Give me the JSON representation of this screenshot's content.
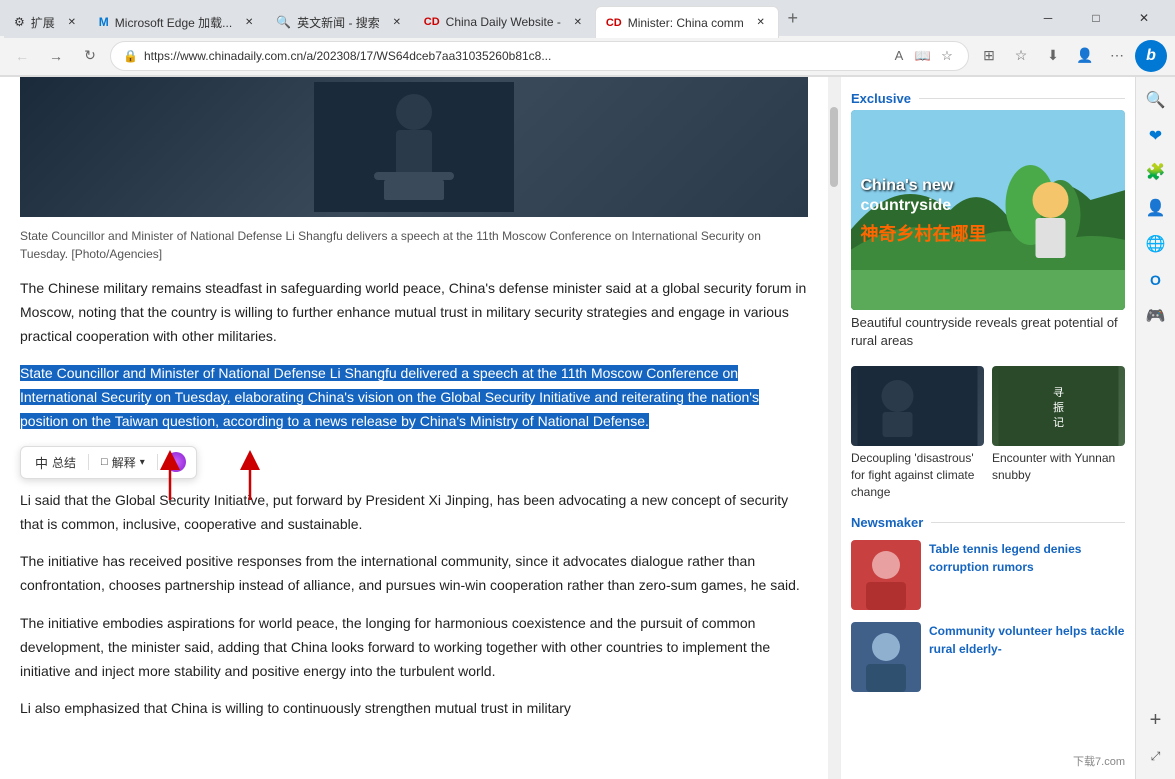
{
  "browser": {
    "tabs": [
      {
        "id": "tab1",
        "label": "扩展",
        "icon": "⚙",
        "active": false
      },
      {
        "id": "tab2",
        "label": "Microsoft Edge 加载...",
        "icon": "M",
        "active": false
      },
      {
        "id": "tab3",
        "label": "英文新闻 - 搜索",
        "icon": "🔍",
        "active": false
      },
      {
        "id": "tab4",
        "label": "China Daily Website -",
        "icon": "CD",
        "active": false
      },
      {
        "id": "tab5",
        "label": "Minister: China comm",
        "icon": "CD",
        "active": true
      }
    ],
    "url": "https://www.chinadaily.com.cn/a/202308/17/WS64dceb7aa31035260b81c8...",
    "window_controls": {
      "minimize": "─",
      "maximize": "□",
      "close": "✕"
    }
  },
  "article": {
    "caption": "State Councillor and Minister of National Defense Li Shangfu delivers a speech at the 11th Moscow Conference on International Security on Tuesday. [Photo/Agencies]",
    "para1": "The Chinese military remains steadfast in safeguarding world peace, China's defense minister said at a global security forum in Moscow, noting that the country is willing to further enhance mutual trust in military security strategies and engage in various practical cooperation with other militaries.",
    "highlighted": "State Councillor and Minister of National Defense Li Shangfu delivered a speech at the 11th Moscow Conference on International Security on Tuesday, elaborating China's vision on the Global Security Initiative and reiterating the nation's position on the Taiwan question, according to a news release by China's Ministry of National Defense.",
    "selection_toolbar": {
      "summarize": "总结",
      "explain": "解释"
    },
    "para3": "Li said that the Global Security Initiative, put forward by President Xi Jinping, has been advocating a new concept of security that is common, inclusive, cooperative and sustainable.",
    "para4": "The initiative has received positive responses from the international community, since it advocates dialogue rather than confrontation, chooses partnership instead of alliance, and pursues win-win cooperation rather than zero-sum games, he said.",
    "para5": "The initiative embodies aspirations for world peace, the longing for harmonious coexistence and the pursuit of common development, the minister said, adding that China looks forward to working together with other countries to implement the initiative and inject more stability and positive energy into the turbulent world.",
    "para6": "Li also emphasized that China is willing to continuously strengthen mutual trust in military"
  },
  "sidebar": {
    "exclusive_label": "Exclusive",
    "hero_caption": "Beautiful countryside reveals great potential of rural areas",
    "hero_text_en": "China's new countryside",
    "hero_text_cn": "神奇乡村在哪里",
    "news_items": [
      {
        "title": "Decoupling 'disastrous' for fight against climate change"
      },
      {
        "title": "Encounter with Yunnan snubby"
      }
    ],
    "newsmaker_label": "Newsmaker",
    "newsmaker_items": [
      {
        "title": "Table tennis legend denies corruption rumors"
      },
      {
        "title": "Community volunteer helps tackle rural elderly-"
      }
    ]
  },
  "edge_sidebar_icons": [
    "🔍",
    "♥",
    "🧩",
    "👤",
    "🌐",
    "📧",
    "🎮",
    "+"
  ],
  "watermark": "下载7.com"
}
